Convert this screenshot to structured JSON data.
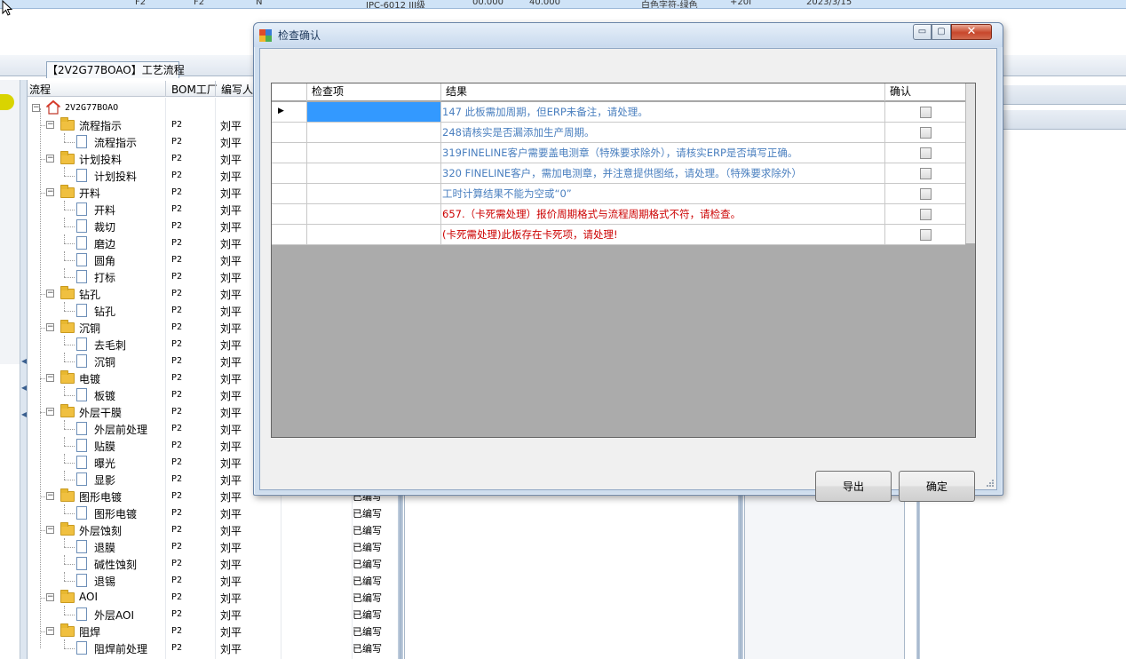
{
  "background_app": {
    "top_strip": [
      "F2",
      "F2",
      "N",
      "IPC-6012 III级",
      "00.000",
      "40.000",
      "白色字符-绿色",
      "+20I",
      "2023/3/15"
    ],
    "process_tab_label": "【2V2G77BOAO】工艺流程",
    "tree": {
      "headers": [
        "流程",
        "BOM工厂",
        "编写人"
      ],
      "root_label": "2V2G77BOAO",
      "nodes": [
        {
          "label": "流程指示",
          "level": 1,
          "factory": "P2",
          "author": "刘平",
          "status": ""
        },
        {
          "label": "流程指示",
          "level": 2,
          "factory": "P2",
          "author": "刘平",
          "status": ""
        },
        {
          "label": "计划投料",
          "level": 1,
          "factory": "P2",
          "author": "刘平",
          "status": ""
        },
        {
          "label": "计划投料",
          "level": 2,
          "factory": "P2",
          "author": "刘平",
          "status": ""
        },
        {
          "label": "开料",
          "level": 1,
          "factory": "P2",
          "author": "刘平",
          "status": ""
        },
        {
          "label": "开料",
          "level": 2,
          "factory": "P2",
          "author": "刘平",
          "status": ""
        },
        {
          "label": "裁切",
          "level": 2,
          "factory": "P2",
          "author": "刘平",
          "status": ""
        },
        {
          "label": "磨边",
          "level": 2,
          "factory": "P2",
          "author": "刘平",
          "status": ""
        },
        {
          "label": "圆角",
          "level": 2,
          "factory": "P2",
          "author": "刘平",
          "status": ""
        },
        {
          "label": "打标",
          "level": 2,
          "factory": "P2",
          "author": "刘平",
          "status": ""
        },
        {
          "label": "钻孔",
          "level": 1,
          "factory": "P2",
          "author": "刘平",
          "status": ""
        },
        {
          "label": "钻孔",
          "level": 2,
          "factory": "P2",
          "author": "刘平",
          "status": ""
        },
        {
          "label": "沉铜",
          "level": 1,
          "factory": "P2",
          "author": "刘平",
          "status": ""
        },
        {
          "label": "去毛刺",
          "level": 2,
          "factory": "P2",
          "author": "刘平",
          "status": ""
        },
        {
          "label": "沉铜",
          "level": 2,
          "factory": "P2",
          "author": "刘平",
          "status": ""
        },
        {
          "label": "电镀",
          "level": 1,
          "factory": "P2",
          "author": "刘平",
          "status": ""
        },
        {
          "label": "板镀",
          "level": 2,
          "factory": "P2",
          "author": "刘平",
          "status": ""
        },
        {
          "label": "外层干膜",
          "level": 1,
          "factory": "P2",
          "author": "刘平",
          "status": ""
        },
        {
          "label": "外层前处理",
          "level": 2,
          "factory": "P2",
          "author": "刘平",
          "status": ""
        },
        {
          "label": "贴膜",
          "level": 2,
          "factory": "P2",
          "author": "刘平",
          "status": ""
        },
        {
          "label": "曝光",
          "level": 2,
          "factory": "P2",
          "author": "刘平",
          "status": ""
        },
        {
          "label": "显影",
          "level": 2,
          "factory": "P2",
          "author": "刘平",
          "status": ""
        },
        {
          "label": "图形电镀",
          "level": 1,
          "factory": "P2",
          "author": "刘平",
          "status": "已编写"
        },
        {
          "label": "图形电镀",
          "level": 2,
          "factory": "P2",
          "author": "刘平",
          "status": "已编写"
        },
        {
          "label": "外层蚀刻",
          "level": 1,
          "factory": "P2",
          "author": "刘平",
          "status": "已编写"
        },
        {
          "label": "退膜",
          "level": 2,
          "factory": "P2",
          "author": "刘平",
          "status": "已编写"
        },
        {
          "label": "碱性蚀刻",
          "level": 2,
          "factory": "P2",
          "author": "刘平",
          "status": "已编写"
        },
        {
          "label": "退锡",
          "level": 2,
          "factory": "P2",
          "author": "刘平",
          "status": "已编写"
        },
        {
          "label": "AOI",
          "level": 1,
          "factory": "P2",
          "author": "刘平",
          "status": "已编写"
        },
        {
          "label": "外层AOI",
          "level": 2,
          "factory": "P2",
          "author": "刘平",
          "status": "已编写"
        },
        {
          "label": "阻焊",
          "level": 1,
          "factory": "P2",
          "author": "刘平",
          "status": "已编写"
        },
        {
          "label": "阻焊前处理",
          "level": 2,
          "factory": "P2",
          "author": "刘平",
          "status": "已编写"
        }
      ]
    }
  },
  "dialog": {
    "title": "检查确认",
    "window_buttons": {
      "minimize": "▭",
      "maximize": "▢",
      "close": "✕"
    },
    "grid": {
      "headers": [
        "检查项",
        "结果",
        "确认"
      ],
      "rows": [
        {
          "item": "",
          "result": "147 此板需加周期，但ERP未备注，请处理。",
          "color": "#4a7fbf",
          "selected": true,
          "confirmed": false
        },
        {
          "item": "",
          "result": "248请核实是否漏添加生产周期。",
          "color": "#4a7fbf",
          "selected": false,
          "confirmed": false
        },
        {
          "item": "",
          "result": "319FINELINE客户需要盖电测章（特殊要求除外），请核实ERP是否填写正确。",
          "color": "#4a7fbf",
          "selected": false,
          "confirmed": false
        },
        {
          "item": "",
          "result": "320 FINELINE客户，需加电测章，并注意提供图纸，请处理。（特殊要求除外）",
          "color": "#4a7fbf",
          "selected": false,
          "confirmed": false
        },
        {
          "item": "",
          "result": "工时计算结果不能为空或“0”",
          "color": "#4a7fbf",
          "selected": false,
          "confirmed": false
        },
        {
          "item": "",
          "result": "657.（卡死需处理）报价周期格式与流程周期格式不符，请检查。",
          "color": "#cc0000",
          "selected": false,
          "confirmed": false
        },
        {
          "item": "",
          "result": "(卡死需处理)此板存在卡死项，请处理!",
          "color": "#cc0000",
          "selected": false,
          "confirmed": false
        }
      ]
    },
    "buttons": {
      "export": "导出",
      "ok": "确定"
    }
  }
}
